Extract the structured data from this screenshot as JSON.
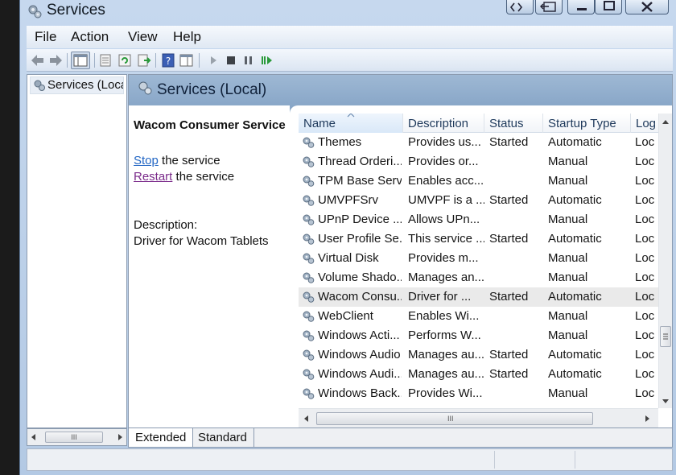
{
  "window": {
    "title": "Services"
  },
  "menu": [
    "File",
    "Action",
    "View",
    "Help"
  ],
  "tree": {
    "root_label": "Services (Loca"
  },
  "pane": {
    "title": "Services (Local)"
  },
  "detail": {
    "service_name": "Wacom Consumer Service",
    "stop_link": "Stop",
    "stop_rest": " the service",
    "restart_link": "Restart",
    "restart_rest": " the service",
    "description_label": "Description:",
    "description_text": "Driver for Wacom Tablets"
  },
  "columns": [
    "Name",
    "Description",
    "Status",
    "Startup Type",
    "Log"
  ],
  "rows": [
    {
      "name": "Themes",
      "description": "Provides us...",
      "status": "Started",
      "startup": "Automatic",
      "log": "Loc"
    },
    {
      "name": "Thread Orderi...",
      "description": "Provides or...",
      "status": "",
      "startup": "Manual",
      "log": "Loc"
    },
    {
      "name": "TPM Base Serv...",
      "description": "Enables acc...",
      "status": "",
      "startup": "Manual",
      "log": "Loc"
    },
    {
      "name": "UMVPFSrv",
      "description": "UMVPF is a ...",
      "status": "Started",
      "startup": "Automatic",
      "log": "Loc"
    },
    {
      "name": "UPnP Device ...",
      "description": "Allows UPn...",
      "status": "",
      "startup": "Manual",
      "log": "Loc"
    },
    {
      "name": "User Profile Se...",
      "description": "This service ...",
      "status": "Started",
      "startup": "Automatic",
      "log": "Loc"
    },
    {
      "name": "Virtual Disk",
      "description": "Provides m...",
      "status": "",
      "startup": "Manual",
      "log": "Loc"
    },
    {
      "name": "Volume Shado...",
      "description": "Manages an...",
      "status": "",
      "startup": "Manual",
      "log": "Loc"
    },
    {
      "name": "Wacom Consu...",
      "description": "Driver for ...",
      "status": "Started",
      "startup": "Automatic",
      "log": "Loc"
    },
    {
      "name": "WebClient",
      "description": "Enables Wi...",
      "status": "",
      "startup": "Manual",
      "log": "Loc"
    },
    {
      "name": "Windows Acti...",
      "description": "Performs W...",
      "status": "",
      "startup": "Manual",
      "log": "Loc"
    },
    {
      "name": "Windows Audio",
      "description": "Manages au...",
      "status": "Started",
      "startup": "Automatic",
      "log": "Loc"
    },
    {
      "name": "Windows Audi...",
      "description": "Manages au...",
      "status": "Started",
      "startup": "Automatic",
      "log": "Loc"
    },
    {
      "name": "Windows Back...",
      "description": "Provides Wi...",
      "status": "",
      "startup": "Manual",
      "log": "Loc"
    }
  ],
  "selected_row": "Wacom Consu...",
  "tabs": [
    "Extended",
    "Standard"
  ],
  "active_tab": "Extended",
  "scroll_thumb_glyph": "III",
  "colors": {
    "link": "#2266c4",
    "visited_link": "#7a2a8a",
    "header": "#89a7c8",
    "selected_row": "#eaeaea"
  }
}
